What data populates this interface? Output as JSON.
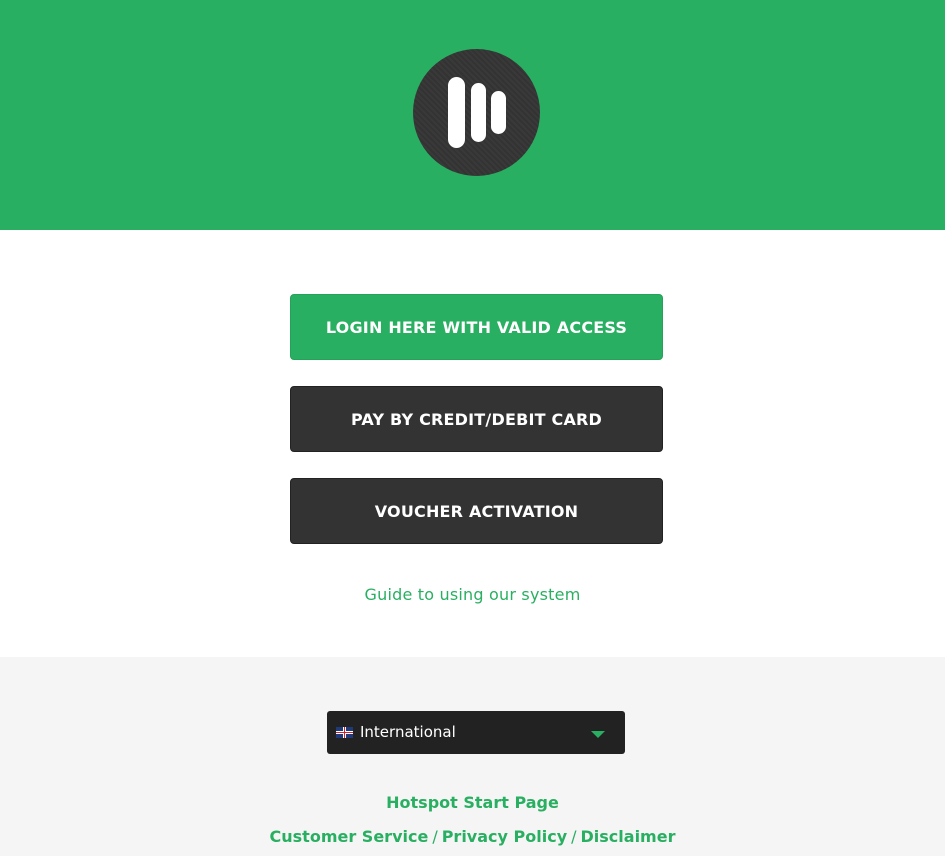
{
  "header": {
    "logo_icon": "bars-logo-icon",
    "background_color": "#29af61"
  },
  "main": {
    "login_button": "LOGIN HERE WITH VALID ACCESS",
    "card_button": "PAY BY CREDIT/DEBIT CARD",
    "voucher_button": "VOUCHER ACTIVATION",
    "guide_link": "Guide to using our system"
  },
  "footer": {
    "language": {
      "flag_icon": "uk-flag-icon",
      "selected": "International"
    },
    "links": {
      "hotspot_start": "Hotspot Start Page",
      "customer_service": "Customer Service",
      "separator1": "/",
      "privacy_policy": "Privacy Policy",
      "separator2": "/",
      "disclaimer": "Disclaimer"
    }
  },
  "colors": {
    "accent": "#29af61",
    "dark_button": "#333333",
    "footer_bg": "#f5f5f5"
  }
}
